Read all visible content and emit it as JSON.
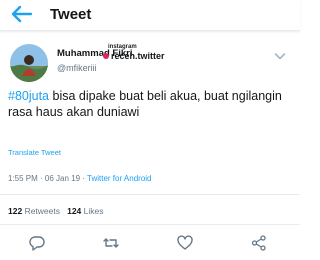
{
  "header": {
    "title": "Tweet",
    "back_icon": "arrow-left-icon"
  },
  "tweet": {
    "author": {
      "display_name": "Muhammad Fikri",
      "username": "@mfikeriii",
      "avatar_icon": "profile-photo"
    },
    "watermark": {
      "top_label": "instagram",
      "handle": "receh.twitter",
      "dot_color": "#e0245e"
    },
    "hashtag": "#80juta",
    "body": " bisa dipake buat beli akua, buat ngilangin rasa haus akan duniawi",
    "translate_label": "Translate Tweet",
    "time": "1:55 PM",
    "separator": " · ",
    "date": "06 Jan 19",
    "source": "Twitter for Android",
    "stats": {
      "retweets_count": "122",
      "retweets_label": "Retweets",
      "likes_count": "124",
      "likes_label": "Likes"
    }
  },
  "actions": [
    {
      "icon": "reply-icon"
    },
    {
      "icon": "retweet-icon"
    },
    {
      "icon": "like-icon"
    },
    {
      "icon": "share-icon"
    }
  ],
  "colors": {
    "accent": "#1da1f2",
    "secondary_text": "#657786",
    "primary_text": "#14171a",
    "divider": "#e6ecf0"
  }
}
